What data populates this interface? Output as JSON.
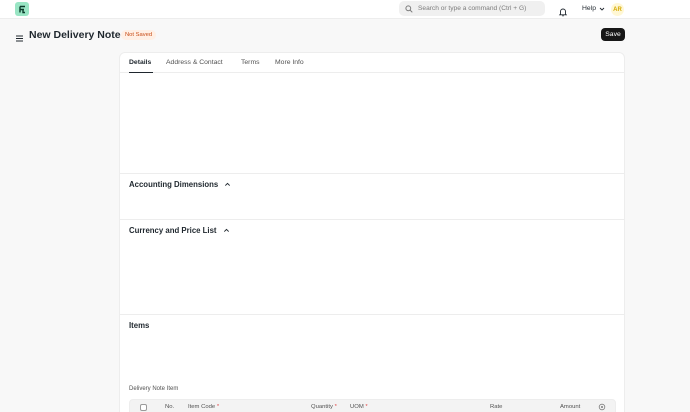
{
  "colors": {
    "brand": "#99e5c4",
    "primary_button": "#171717",
    "not_saved_bg": "#fff0e5",
    "not_saved_text": "#c74b15",
    "avatar_bg": "#fff7d4",
    "avatar_text": "#d4a900",
    "required": "#e24c4c"
  },
  "navbar": {
    "logo_icon": "frappe-logo-icon",
    "logo_text": "F",
    "search_placeholder": "Search or type a command (Ctrl + G)",
    "notifications_icon": "bell-icon",
    "help_label": "Help",
    "avatar_initials": "AR"
  },
  "page": {
    "title": "New Delivery Note",
    "status": "Not Saved",
    "save_label": "Save"
  },
  "tabs": [
    {
      "label": "Details",
      "active": true
    },
    {
      "label": "Address & Contact",
      "active": false
    },
    {
      "label": "Terms",
      "active": false
    },
    {
      "label": "More Info",
      "active": false
    }
  ],
  "sections": {
    "accounting_dimensions": "Accounting Dimensions",
    "currency_price_list": "Currency and Price List",
    "items": "Items"
  },
  "items_table": {
    "label": "Delivery Note Item",
    "columns": [
      {
        "label": "No.",
        "required": false
      },
      {
        "label": "Item Code",
        "required": true
      },
      {
        "label": "Quantity",
        "required": true
      },
      {
        "label": "UOM",
        "required": true
      },
      {
        "label": "Rate",
        "required": false
      },
      {
        "label": "Amount",
        "required": false
      }
    ],
    "required_mark": "*",
    "settings_icon": "gear-icon"
  }
}
